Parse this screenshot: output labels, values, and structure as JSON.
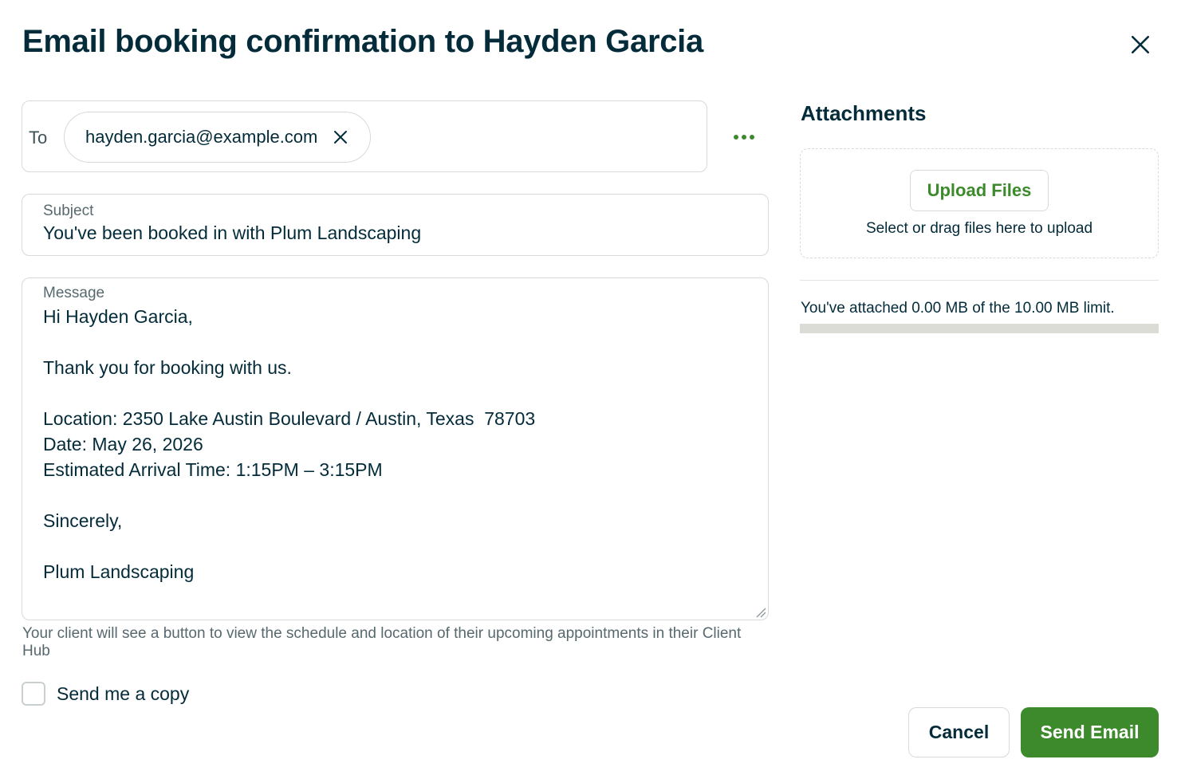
{
  "dialog": {
    "title": "Email booking confirmation to Hayden Garcia"
  },
  "recipients": {
    "to_label": "To",
    "chips": [
      {
        "email": "hayden.garcia@example.com"
      }
    ],
    "more_icon": "ellipsis-icon"
  },
  "subject": {
    "label": "Subject",
    "value": "You've been booked in with Plum Landscaping"
  },
  "message": {
    "label": "Message",
    "body": "Hi Hayden Garcia,\n\nThank you for booking with us.\n\nLocation: 2350 Lake Austin Boulevard / Austin, Texas  78703\nDate: May 26, 2026\nEstimated Arrival Time: 1:15PM – 3:15PM\n\nSincerely,\n\nPlum Landscaping",
    "hint": "Your client will see a button to view the schedule and location of their upcoming appointments in their Client Hub"
  },
  "send_copy": {
    "label": "Send me a copy",
    "checked": false
  },
  "attachments": {
    "title": "Attachments",
    "upload_label": "Upload Files",
    "drop_hint": "Select or drag files here to upload",
    "limit_text": "You've attached 0.00 MB of the 10.00 MB limit.",
    "used_fraction": 0
  },
  "actions": {
    "cancel_label": "Cancel",
    "send_label": "Send Email"
  },
  "colors": {
    "primary_green": "#3d8a2c",
    "text_dark": "#032b3a",
    "border": "#d6dadb"
  }
}
